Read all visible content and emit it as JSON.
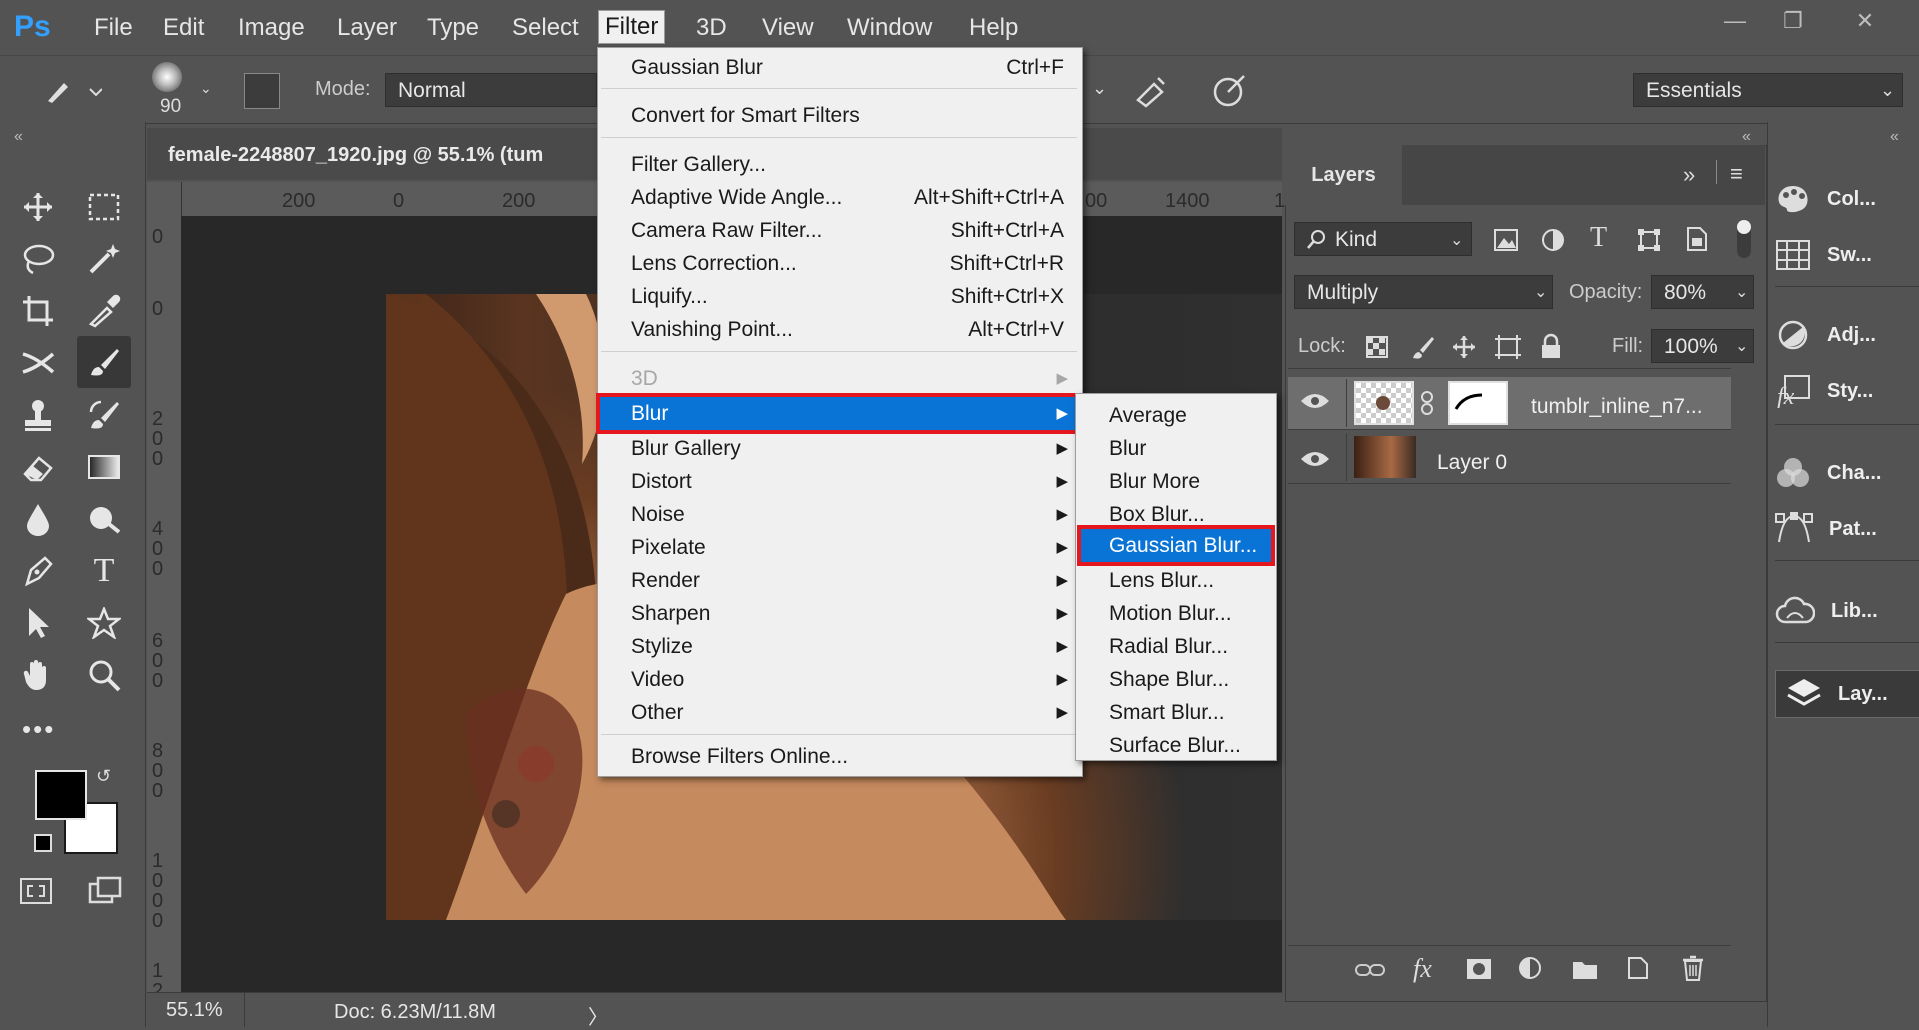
{
  "app": {
    "logo": "Ps"
  },
  "menubar": {
    "items": [
      "File",
      "Edit",
      "Image",
      "Layer",
      "Type",
      "Select",
      "Filter",
      "3D",
      "View",
      "Window",
      "Help"
    ],
    "active": "Filter",
    "window_controls": [
      "minimize-icon",
      "restore-icon",
      "close-icon"
    ]
  },
  "options_bar": {
    "brush_size": "90",
    "mode_label": "Mode:",
    "mode_value": "Normal",
    "workspace": "Essentials"
  },
  "document": {
    "tab_title": "female-2248807_1920.jpg @ 55.1% (tum",
    "ruler_top": [
      "200",
      "0",
      "200",
      "00",
      "1400",
      "1"
    ],
    "ruler_left": [
      "0",
      "0",
      "2",
      "0",
      "0",
      "4",
      "0",
      "0",
      "6",
      "0",
      "0",
      "8",
      "0",
      "0",
      "1",
      "0",
      "0",
      "0",
      "1",
      "2"
    ],
    "zoom": "55.1%",
    "doc_info": "Doc: 6.23M/11.8M",
    "status_arrow": "〉"
  },
  "filter_menu": {
    "last_filter": {
      "label": "Gaussian Blur",
      "shortcut": "Ctrl+F"
    },
    "convert": "Convert for Smart Filters",
    "items": [
      {
        "label": "Filter Gallery...",
        "shortcut": ""
      },
      {
        "label": "Adaptive Wide Angle...",
        "shortcut": "Alt+Shift+Ctrl+A"
      },
      {
        "label": "Camera Raw Filter...",
        "shortcut": "Shift+Ctrl+A"
      },
      {
        "label": "Lens Correction...",
        "shortcut": "Shift+Ctrl+R"
      },
      {
        "label": "Liquify...",
        "shortcut": "Shift+Ctrl+X"
      },
      {
        "label": "Vanishing Point...",
        "shortcut": "Alt+Ctrl+V"
      }
    ],
    "submenus": [
      "3D",
      "Blur",
      "Blur Gallery",
      "Distort",
      "Noise",
      "Pixelate",
      "Render",
      "Sharpen",
      "Stylize",
      "Video",
      "Other"
    ],
    "highlighted": "Blur",
    "browse": "Browse Filters Online..."
  },
  "blur_menu": {
    "items": [
      "Average",
      "Blur",
      "Blur More",
      "Box Blur...",
      "Gaussian Blur...",
      "Lens Blur...",
      "Motion Blur...",
      "Radial Blur...",
      "Shape Blur...",
      "Smart Blur...",
      "Surface Blur..."
    ],
    "highlighted": "Gaussian Blur..."
  },
  "layers_panel": {
    "tab": "Layers",
    "filter_kind": "Kind",
    "blend_mode": "Multiply",
    "opacity_label": "Opacity:",
    "opacity_value": "80%",
    "lock_label": "Lock:",
    "fill_label": "Fill:",
    "fill_value": "100%",
    "layers": [
      {
        "name": "tumblr_inline_n7...",
        "selected": true
      },
      {
        "name": "Layer 0",
        "selected": false
      }
    ]
  },
  "right_panel": {
    "items": [
      "Col...",
      "Sw...",
      "Adj...",
      "Sty...",
      "Cha...",
      "Pat...",
      "Lib...",
      "Lay..."
    ]
  },
  "colors": {
    "accent": "#0a74d6",
    "highlight_border": "#e3171d",
    "ps_blue": "#33a0ff"
  }
}
